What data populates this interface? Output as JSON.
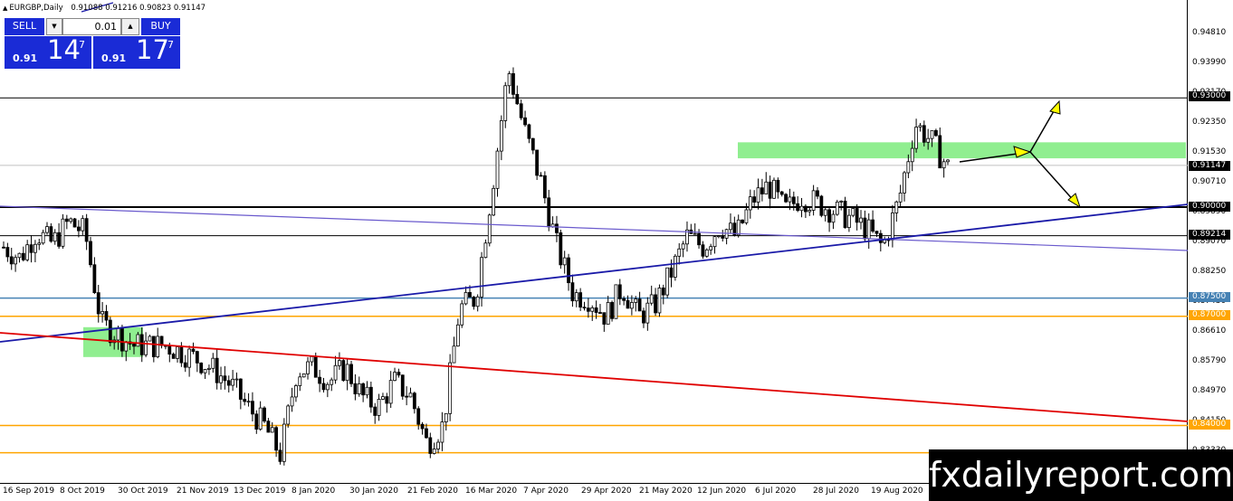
{
  "header": {
    "symbol": "EURGBP,Daily",
    "ohlc": "0.91088 0.91216 0.90823 0.91147"
  },
  "trade_panel": {
    "sell_label": "SELL",
    "buy_label": "BUY",
    "lot_value": "0.01",
    "sell_price": {
      "prefix": "0.91",
      "big": "14",
      "sup": "7"
    },
    "buy_price": {
      "prefix": "0.91",
      "big": "17",
      "sup": "7"
    }
  },
  "price_axis": {
    "ticks": [
      "0.94810",
      "0.93990",
      "0.93170",
      "0.92350",
      "0.91530",
      "0.90710",
      "0.89890",
      "0.89070",
      "0.88250",
      "0.87430",
      "0.86610",
      "0.85790",
      "0.84970",
      "0.84150",
      "0.83330"
    ],
    "labels": [
      {
        "text": "0.93000",
        "color": "#ffffff",
        "bg": "#000000"
      },
      {
        "text": "0.91147",
        "color": "#ffffff",
        "bg": "#000000"
      },
      {
        "text": "0.90000",
        "color": "#ffffff",
        "bg": "#000000"
      },
      {
        "text": "0.89214",
        "color": "#ffffff",
        "bg": "#000000"
      },
      {
        "text": "0.87500",
        "color": "#ffffff",
        "bg": "#4682b4"
      },
      {
        "text": "0.87000",
        "color": "#ffffff",
        "bg": "#ffa500"
      },
      {
        "text": "0.84000",
        "color": "#ffffff",
        "bg": "#ffa500"
      }
    ]
  },
  "time_axis": {
    "ticks": [
      "16 Sep 2019",
      "8 Oct 2019",
      "30 Oct 2019",
      "21 Nov 2019",
      "13 Dec 2019",
      "8 Jan 2020",
      "30 Jan 2020",
      "21 Feb 2020",
      "16 Mar 2020",
      "7 Apr 2020",
      "29 Apr 2020",
      "21 May 2020",
      "12 Jun 2020",
      "6 Jul 2020",
      "28 Jul 2020",
      "19 Aug 2020"
    ]
  },
  "watermark": "fxdailyreport.com",
  "colors": {
    "accent": "#1a2bd6",
    "zone": "#90ee90",
    "support_orange": "#ffa500",
    "level_steel": "#4682b4",
    "trend_red": "#e00000",
    "trend_blue": "#1a1aa8",
    "trend_slate": "#6a5acd",
    "arrow_yellow": "#ffff00"
  },
  "chart_data": {
    "type": "candlestick",
    "symbol": "EURGBP",
    "timeframe": "Daily",
    "ylim": [
      0.829,
      0.954
    ],
    "x": [
      "16 Sep 2019",
      "8 Oct 2019",
      "30 Oct 2019",
      "21 Nov 2019",
      "13 Dec 2019",
      "8 Jan 2020",
      "30 Jan 2020",
      "21 Feb 2020",
      "16 Mar 2020",
      "7 Apr 2020",
      "29 Apr 2020",
      "21 May 2020",
      "12 Jun 2020",
      "6 Jul 2020",
      "28 Jul 2020",
      "19 Aug 2020"
    ],
    "close_path": [
      0.889,
      0.886,
      0.893,
      0.89,
      0.896,
      0.893,
      0.868,
      0.865,
      0.862,
      0.862,
      0.862,
      0.86,
      0.858,
      0.855,
      0.851,
      0.845,
      0.84,
      0.832,
      0.855,
      0.856,
      0.852,
      0.856,
      0.848,
      0.845,
      0.852,
      0.848,
      0.835,
      0.84,
      0.872,
      0.875,
      0.905,
      0.938,
      0.921,
      0.907,
      0.889,
      0.876,
      0.875,
      0.87,
      0.878,
      0.87,
      0.873,
      0.882,
      0.892,
      0.889,
      0.895,
      0.892,
      0.902,
      0.906,
      0.899,
      0.903,
      0.901,
      0.899,
      0.897,
      0.894,
      0.889,
      0.902,
      0.923,
      0.918,
      0.911
    ],
    "horizontal_levels": [
      0.93,
      0.9,
      0.89214,
      0.875,
      0.87,
      0.84,
      0.835
    ],
    "current_price": 0.91147
  }
}
